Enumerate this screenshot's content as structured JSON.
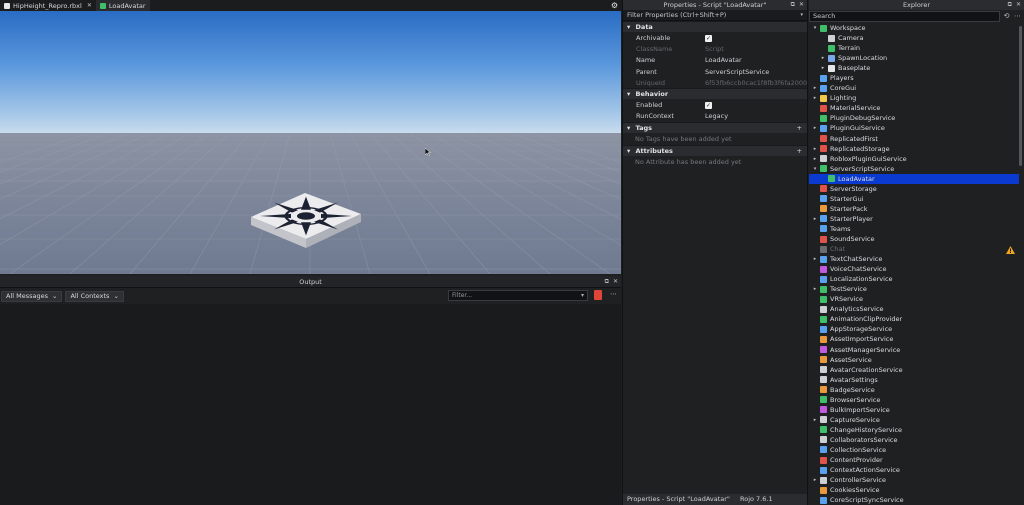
{
  "tabs": [
    {
      "label": "HipHeight_Repro.rbxl",
      "icon_color": "#ffffff",
      "active": false
    },
    {
      "label": "LoadAvatar",
      "icon_color": "#3fbf6a",
      "active": true
    }
  ],
  "icons": {
    "settings": "gear-icon",
    "close": "close-icon"
  },
  "output": {
    "title": "Output",
    "messages_filter": "All Messages",
    "contexts_filter": "All Contexts",
    "filter_placeholder": "Filter..."
  },
  "properties": {
    "title": "Properties - Script \"LoadAvatar\"",
    "filter_placeholder": "Filter Properties (Ctrl+Shift+P)",
    "sections": {
      "data": "Data",
      "behavior": "Behavior",
      "tags": "Tags",
      "attributes": "Attributes"
    },
    "data_rows": [
      {
        "name": "Archivable",
        "value": "",
        "checked": true
      },
      {
        "name": "ClassName",
        "value": "Script",
        "dim": true
      },
      {
        "name": "Name",
        "value": "LoadAvatar"
      },
      {
        "name": "Parent",
        "value": "ServerScriptService"
      },
      {
        "name": "UniqueId",
        "value": "6f53fb6ccb0cac1f8fb3f6fa2000...",
        "dim": true
      }
    ],
    "behavior_rows": [
      {
        "name": "Enabled",
        "value": "",
        "checked": true
      },
      {
        "name": "RunContext",
        "value": "Legacy"
      }
    ],
    "tags_empty": "No Tags have been added yet",
    "attributes_empty": "No Attribute has been added yet",
    "status": "Properties - Script \"LoadAvatar\"",
    "status_extra": "Rojo 7.6.1"
  },
  "explorer": {
    "title": "Explorer",
    "search_placeholder": "Search",
    "items": [
      {
        "label": "Workspace",
        "indent": 0,
        "expander": "▾",
        "color": "#3fbf6a"
      },
      {
        "label": "Camera",
        "indent": 1,
        "expander": "",
        "color": "#cfd0d3"
      },
      {
        "label": "Terrain",
        "indent": 1,
        "expander": "",
        "color": "#3fbf6a"
      },
      {
        "label": "SpawnLocation",
        "indent": 1,
        "expander": "▸",
        "color": "#7aa7e8"
      },
      {
        "label": "Baseplate",
        "indent": 1,
        "expander": "▸",
        "color": "#e6e6e6"
      },
      {
        "label": "Players",
        "indent": 0,
        "expander": "",
        "color": "#5aa2f0"
      },
      {
        "label": "CoreGui",
        "indent": 0,
        "expander": "▸",
        "color": "#5aa2f0"
      },
      {
        "label": "Lighting",
        "indent": 0,
        "expander": "▸",
        "color": "#f2c84b"
      },
      {
        "label": "MaterialService",
        "indent": 0,
        "expander": "",
        "color": "#e0534a"
      },
      {
        "label": "PluginDebugService",
        "indent": 0,
        "expander": "",
        "color": "#3fbf6a"
      },
      {
        "label": "PluginGuiService",
        "indent": 0,
        "expander": "▸",
        "color": "#5aa2f0"
      },
      {
        "label": "ReplicatedFirst",
        "indent": 0,
        "expander": "",
        "color": "#e0534a"
      },
      {
        "label": "ReplicatedStorage",
        "indent": 0,
        "expander": "▸",
        "color": "#e0534a"
      },
      {
        "label": "RobloxPluginGuiService",
        "indent": 0,
        "expander": "▸",
        "color": "#cfd0d3"
      },
      {
        "label": "ServerScriptService",
        "indent": 0,
        "expander": "▾",
        "color": "#3fbf6a"
      },
      {
        "label": "LoadAvatar",
        "indent": 1,
        "expander": "",
        "color": "#3fbf6a",
        "selected": true
      },
      {
        "label": "ServerStorage",
        "indent": 0,
        "expander": "",
        "color": "#e0534a"
      },
      {
        "label": "StarterGui",
        "indent": 0,
        "expander": "",
        "color": "#5aa2f0"
      },
      {
        "label": "StarterPack",
        "indent": 0,
        "expander": "",
        "color": "#e89a3c"
      },
      {
        "label": "StarterPlayer",
        "indent": 0,
        "expander": "▸",
        "color": "#5aa2f0"
      },
      {
        "label": "Teams",
        "indent": 0,
        "expander": "",
        "color": "#5aa2f0"
      },
      {
        "label": "SoundService",
        "indent": 0,
        "expander": "",
        "color": "#e0534a"
      },
      {
        "label": "Chat",
        "indent": 0,
        "expander": "",
        "color": "#6b6c70",
        "dim": true
      },
      {
        "label": "TextChatService",
        "indent": 0,
        "expander": "▸",
        "color": "#5aa2f0"
      },
      {
        "label": "VoiceChatService",
        "indent": 0,
        "expander": "",
        "color": "#c05be0"
      },
      {
        "label": "LocalizationService",
        "indent": 0,
        "expander": "",
        "color": "#5aa2f0"
      },
      {
        "label": "TestService",
        "indent": 0,
        "expander": "▸",
        "color": "#3fbf6a"
      },
      {
        "label": "VRService",
        "indent": 0,
        "expander": "",
        "color": "#3fbf6a"
      },
      {
        "label": "AnalyticsService",
        "indent": 0,
        "expander": "",
        "color": "#cfd0d3"
      },
      {
        "label": "AnimationClipProvider",
        "indent": 0,
        "expander": "",
        "color": "#3fbf6a"
      },
      {
        "label": "AppStorageService",
        "indent": 0,
        "expander": "",
        "color": "#5aa2f0"
      },
      {
        "label": "AssetImportService",
        "indent": 0,
        "expander": "",
        "color": "#e89a3c"
      },
      {
        "label": "AssetManagerService",
        "indent": 0,
        "expander": "",
        "color": "#c05be0"
      },
      {
        "label": "AssetService",
        "indent": 0,
        "expander": "",
        "color": "#e89a3c"
      },
      {
        "label": "AvatarCreationService",
        "indent": 0,
        "expander": "",
        "color": "#cfd0d3"
      },
      {
        "label": "AvatarSettings",
        "indent": 0,
        "expander": "",
        "color": "#cfd0d3"
      },
      {
        "label": "BadgeService",
        "indent": 0,
        "expander": "",
        "color": "#e89a3c"
      },
      {
        "label": "BrowserService",
        "indent": 0,
        "expander": "",
        "color": "#3fbf6a"
      },
      {
        "label": "BulkImportService",
        "indent": 0,
        "expander": "",
        "color": "#c05be0"
      },
      {
        "label": "CaptureService",
        "indent": 0,
        "expander": "▸",
        "color": "#cfd0d3"
      },
      {
        "label": "ChangeHistoryService",
        "indent": 0,
        "expander": "",
        "color": "#3fbf6a"
      },
      {
        "label": "CollaboratorsService",
        "indent": 0,
        "expander": "",
        "color": "#cfd0d3"
      },
      {
        "label": "CollectionService",
        "indent": 0,
        "expander": "",
        "color": "#5aa2f0"
      },
      {
        "label": "ContentProvider",
        "indent": 0,
        "expander": "",
        "color": "#e0534a"
      },
      {
        "label": "ContextActionService",
        "indent": 0,
        "expander": "",
        "color": "#5aa2f0"
      },
      {
        "label": "ControllerService",
        "indent": 0,
        "expander": "▸",
        "color": "#cfd0d3"
      },
      {
        "label": "CookiesService",
        "indent": 0,
        "expander": "",
        "color": "#e89a3c"
      },
      {
        "label": "CoreScriptSyncService",
        "indent": 0,
        "expander": "",
        "color": "#5aa2f0"
      }
    ]
  }
}
